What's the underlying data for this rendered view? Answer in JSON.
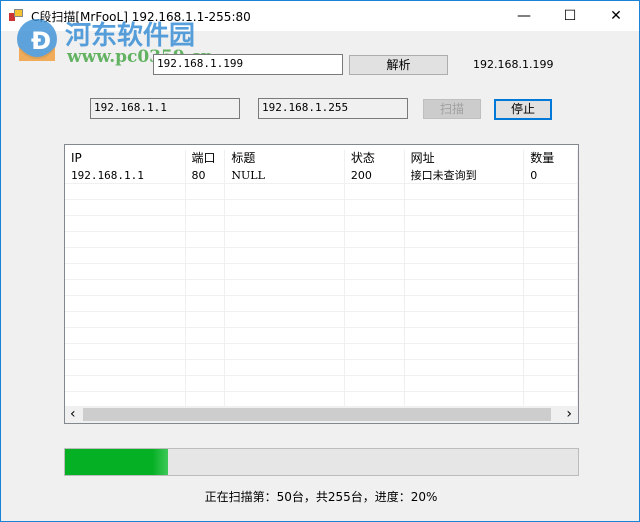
{
  "window": {
    "title": "C段扫描[MrFooL] 192.168.1.1-255:80",
    "minimize": "—",
    "maximize": "☐",
    "close": "✕"
  },
  "watermark": {
    "name": "河东软件园",
    "url": "www.pc0359.cn"
  },
  "resolve": {
    "input": "192.168.1.199",
    "button": "解析",
    "result": "192.168.1.199"
  },
  "scan": {
    "start_ip": "192.168.1.1",
    "end_ip": "192.168.1.255",
    "scan_button": "扫描",
    "stop_button": "停止"
  },
  "table": {
    "columns": [
      "IP",
      "端口",
      "标题",
      "状态",
      "网址",
      "数量"
    ],
    "rows": [
      [
        "192.168.1.1",
        "80",
        "NULL",
        "200",
        "接口未查询到",
        "0"
      ]
    ],
    "scroll_left": "‹",
    "scroll_right": "›"
  },
  "progress": {
    "percent": 20
  },
  "status_text": "正在扫描第：50台，共255台，进度：20%"
}
